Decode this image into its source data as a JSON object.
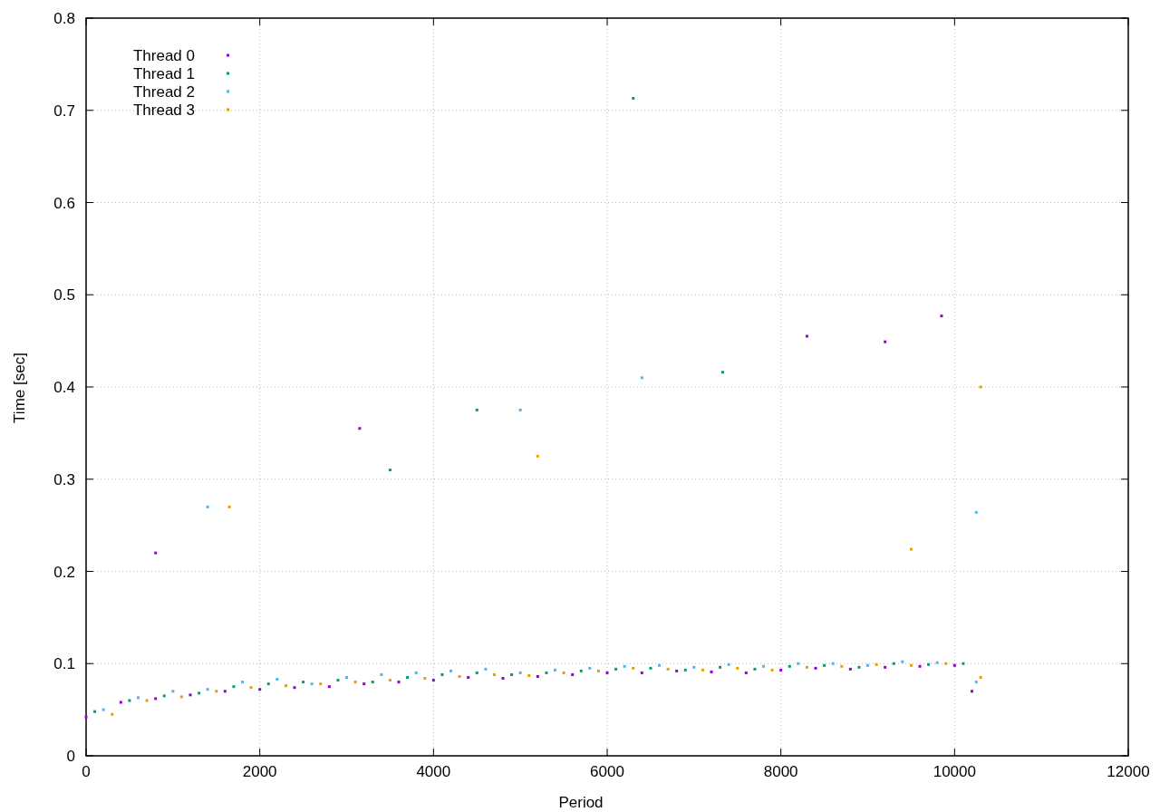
{
  "chart_data": {
    "type": "scatter",
    "grid": true,
    "legend": true,
    "xlabel": "Period",
    "ylabel": "Time [sec]",
    "xlim": [
      0,
      12000
    ],
    "ylim": [
      0,
      0.8
    ],
    "xticks": [
      0,
      2000,
      4000,
      6000,
      8000,
      10000,
      12000
    ],
    "yticks": [
      {
        "value": 0,
        "label": "0"
      },
      {
        "value": 0.1,
        "label": "0.1"
      },
      {
        "value": 0.2,
        "label": "0.2"
      },
      {
        "value": 0.3,
        "label": "0.3"
      },
      {
        "value": 0.4,
        "label": "0.4"
      },
      {
        "value": 0.5,
        "label": "0.5"
      },
      {
        "value": 0.6,
        "label": "0.6"
      },
      {
        "value": 0.7,
        "label": "0.7"
      },
      {
        "value": 0.8,
        "label": "0.8"
      }
    ],
    "series": [
      {
        "name": "Thread 0",
        "color": "#9400d3",
        "x": [
          0,
          400,
          800,
          1200,
          1600,
          2000,
          2400,
          2800,
          3200,
          3600,
          4000,
          4400,
          4800,
          5200,
          5600,
          6000,
          6400,
          6800,
          7200,
          7600,
          8000,
          8400,
          8800,
          9200,
          9600,
          10000,
          10200,
          3150,
          8300,
          9850,
          9200,
          800
        ],
        "values": [
          0.042,
          0.058,
          0.062,
          0.066,
          0.07,
          0.072,
          0.074,
          0.075,
          0.078,
          0.08,
          0.082,
          0.085,
          0.084,
          0.086,
          0.088,
          0.09,
          0.09,
          0.092,
          0.091,
          0.09,
          0.093,
          0.095,
          0.094,
          0.096,
          0.097,
          0.098,
          0.07,
          0.355,
          0.455,
          0.477,
          0.449,
          0.22
        ]
      },
      {
        "name": "Thread 1",
        "color": "#009e73",
        "x": [
          100,
          500,
          900,
          1300,
          1700,
          2100,
          2500,
          2900,
          3300,
          3700,
          4100,
          4500,
          4900,
          5300,
          5700,
          6100,
          6500,
          6900,
          7300,
          7700,
          8100,
          8500,
          8900,
          9300,
          9700,
          10100,
          6300,
          7330,
          3500,
          4500
        ],
        "values": [
          0.048,
          0.06,
          0.065,
          0.068,
          0.075,
          0.078,
          0.08,
          0.082,
          0.08,
          0.085,
          0.088,
          0.09,
          0.088,
          0.09,
          0.092,
          0.094,
          0.095,
          0.093,
          0.096,
          0.094,
          0.097,
          0.098,
          0.096,
          0.1,
          0.099,
          0.1,
          0.713,
          0.416,
          0.31,
          0.375
        ]
      },
      {
        "name": "Thread 2",
        "color": "#56b4e9",
        "x": [
          200,
          600,
          1000,
          1400,
          1800,
          2200,
          2600,
          3000,
          3400,
          3800,
          4200,
          4600,
          5000,
          5400,
          5800,
          6200,
          6600,
          7000,
          7400,
          7800,
          8200,
          8600,
          9000,
          9400,
          9800,
          10250,
          1400,
          5000,
          10250,
          6400
        ],
        "values": [
          0.05,
          0.063,
          0.07,
          0.072,
          0.08,
          0.083,
          0.078,
          0.085,
          0.088,
          0.09,
          0.092,
          0.094,
          0.09,
          0.093,
          0.095,
          0.097,
          0.098,
          0.096,
          0.099,
          0.097,
          0.1,
          0.1,
          0.098,
          0.102,
          0.101,
          0.08,
          0.27,
          0.375,
          0.264,
          0.41
        ]
      },
      {
        "name": "Thread 3",
        "color": "#e69f00",
        "x": [
          300,
          700,
          1100,
          1500,
          1900,
          2300,
          2700,
          3100,
          3500,
          3900,
          4300,
          4700,
          5100,
          5500,
          5900,
          6300,
          6700,
          7100,
          7500,
          7900,
          8300,
          8700,
          9100,
          9500,
          9900,
          10300,
          1650,
          9500,
          10300,
          5200
        ],
        "values": [
          0.045,
          0.06,
          0.064,
          0.07,
          0.074,
          0.076,
          0.078,
          0.08,
          0.082,
          0.084,
          0.086,
          0.088,
          0.087,
          0.09,
          0.092,
          0.095,
          0.094,
          0.093,
          0.095,
          0.093,
          0.096,
          0.097,
          0.099,
          0.098,
          0.1,
          0.085,
          0.27,
          0.224,
          0.4,
          0.325
        ]
      }
    ]
  }
}
